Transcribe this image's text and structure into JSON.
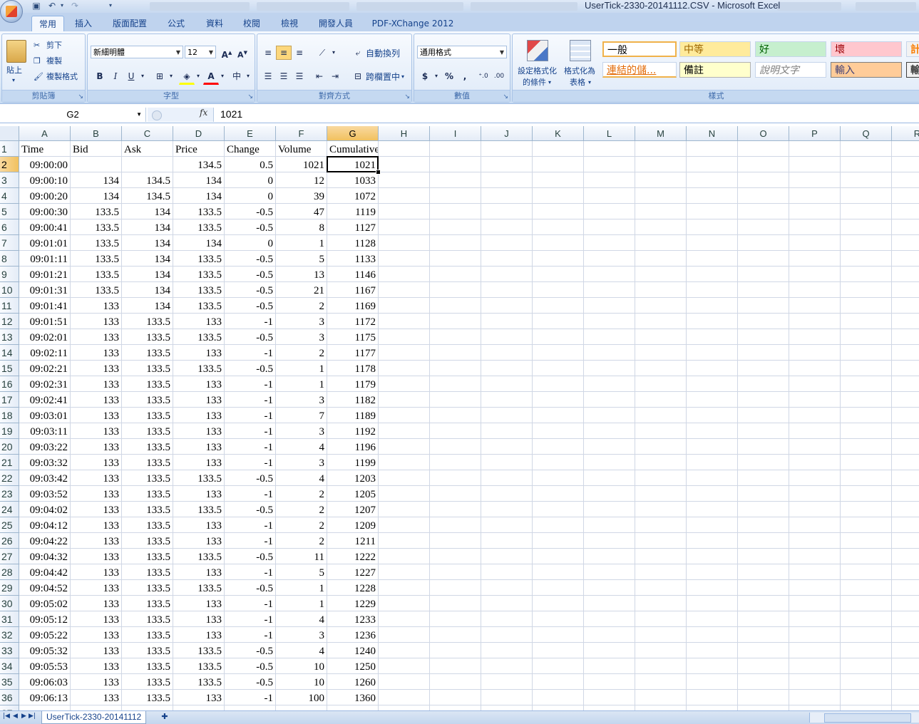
{
  "window": {
    "title": "UserTick-2330-20141112.CSV - Microsoft Excel"
  },
  "ribbon": {
    "tabs": [
      "常用",
      "插入",
      "版面配置",
      "公式",
      "資料",
      "校閱",
      "檢視",
      "開發人員",
      "PDF-XChange 2012"
    ],
    "active_tab": "常用",
    "clipboard": {
      "paste": "貼上",
      "cut": "剪下",
      "copy": "複製",
      "format_painter": "複製格式",
      "label": "剪貼簿"
    },
    "font": {
      "name": "新細明體",
      "size": "12",
      "label": "字型"
    },
    "alignment": {
      "wrap_text": "自動換列",
      "merge_center": "跨欄置中",
      "label": "對齊方式"
    },
    "number": {
      "format": "通用格式",
      "label": "數值"
    },
    "styles": {
      "conditional_formatting_1": "設定格式化",
      "conditional_formatting_2": "的條件",
      "format_as_table_1": "格式化為",
      "format_as_table_2": "表格",
      "normal": "一般",
      "neutral": "中等",
      "good": "好",
      "bad": "壞",
      "calc_partial": "計",
      "hyperlink": "連結的儲...",
      "note": "備註",
      "explanatory": "說明文字",
      "input": "輸入",
      "output_partial": "輸",
      "label": "樣式"
    }
  },
  "formula_bar": {
    "name_box": "G2",
    "fx": "fx",
    "value": "1021"
  },
  "sheet": {
    "columns": [
      "A",
      "B",
      "C",
      "D",
      "E",
      "F",
      "G",
      "H",
      "I",
      "J",
      "K",
      "L",
      "M",
      "N",
      "O",
      "P",
      "Q",
      "R"
    ],
    "selected_column": "G",
    "selected_row": 2,
    "header_row": [
      "Time",
      "Bid",
      "Ask",
      "Price",
      "Change",
      "Volume",
      "Cumulative"
    ],
    "rows": [
      [
        "09:00:00",
        "",
        "",
        "134.5",
        "0.5",
        "1021",
        "1021"
      ],
      [
        "09:00:10",
        "134",
        "134.5",
        "134",
        "0",
        "12",
        "1033"
      ],
      [
        "09:00:20",
        "134",
        "134.5",
        "134",
        "0",
        "39",
        "1072"
      ],
      [
        "09:00:30",
        "133.5",
        "134",
        "133.5",
        "-0.5",
        "47",
        "1119"
      ],
      [
        "09:00:41",
        "133.5",
        "134",
        "133.5",
        "-0.5",
        "8",
        "1127"
      ],
      [
        "09:01:01",
        "133.5",
        "134",
        "134",
        "0",
        "1",
        "1128"
      ],
      [
        "09:01:11",
        "133.5",
        "134",
        "133.5",
        "-0.5",
        "5",
        "1133"
      ],
      [
        "09:01:21",
        "133.5",
        "134",
        "133.5",
        "-0.5",
        "13",
        "1146"
      ],
      [
        "09:01:31",
        "133.5",
        "134",
        "133.5",
        "-0.5",
        "21",
        "1167"
      ],
      [
        "09:01:41",
        "133",
        "134",
        "133.5",
        "-0.5",
        "2",
        "1169"
      ],
      [
        "09:01:51",
        "133",
        "133.5",
        "133",
        "-1",
        "3",
        "1172"
      ],
      [
        "09:02:01",
        "133",
        "133.5",
        "133.5",
        "-0.5",
        "3",
        "1175"
      ],
      [
        "09:02:11",
        "133",
        "133.5",
        "133",
        "-1",
        "2",
        "1177"
      ],
      [
        "09:02:21",
        "133",
        "133.5",
        "133.5",
        "-0.5",
        "1",
        "1178"
      ],
      [
        "09:02:31",
        "133",
        "133.5",
        "133",
        "-1",
        "1",
        "1179"
      ],
      [
        "09:02:41",
        "133",
        "133.5",
        "133",
        "-1",
        "3",
        "1182"
      ],
      [
        "09:03:01",
        "133",
        "133.5",
        "133",
        "-1",
        "7",
        "1189"
      ],
      [
        "09:03:11",
        "133",
        "133.5",
        "133",
        "-1",
        "3",
        "1192"
      ],
      [
        "09:03:22",
        "133",
        "133.5",
        "133",
        "-1",
        "4",
        "1196"
      ],
      [
        "09:03:32",
        "133",
        "133.5",
        "133",
        "-1",
        "3",
        "1199"
      ],
      [
        "09:03:42",
        "133",
        "133.5",
        "133.5",
        "-0.5",
        "4",
        "1203"
      ],
      [
        "09:03:52",
        "133",
        "133.5",
        "133",
        "-1",
        "2",
        "1205"
      ],
      [
        "09:04:02",
        "133",
        "133.5",
        "133.5",
        "-0.5",
        "2",
        "1207"
      ],
      [
        "09:04:12",
        "133",
        "133.5",
        "133",
        "-1",
        "2",
        "1209"
      ],
      [
        "09:04:22",
        "133",
        "133.5",
        "133",
        "-1",
        "2",
        "1211"
      ],
      [
        "09:04:32",
        "133",
        "133.5",
        "133.5",
        "-0.5",
        "11",
        "1222"
      ],
      [
        "09:04:42",
        "133",
        "133.5",
        "133",
        "-1",
        "5",
        "1227"
      ],
      [
        "09:04:52",
        "133",
        "133.5",
        "133.5",
        "-0.5",
        "1",
        "1228"
      ],
      [
        "09:05:02",
        "133",
        "133.5",
        "133",
        "-1",
        "1",
        "1229"
      ],
      [
        "09:05:12",
        "133",
        "133.5",
        "133",
        "-1",
        "4",
        "1233"
      ],
      [
        "09:05:22",
        "133",
        "133.5",
        "133",
        "-1",
        "3",
        "1236"
      ],
      [
        "09:05:32",
        "133",
        "133.5",
        "133.5",
        "-0.5",
        "4",
        "1240"
      ],
      [
        "09:05:53",
        "133",
        "133.5",
        "133.5",
        "-0.5",
        "10",
        "1250"
      ],
      [
        "09:06:03",
        "133",
        "133.5",
        "133.5",
        "-0.5",
        "10",
        "1260"
      ],
      [
        "09:06:13",
        "133",
        "133.5",
        "133",
        "-1",
        "100",
        "1360"
      ]
    ]
  },
  "sheet_tabs": {
    "active": "UserTick-2330-20141112"
  },
  "colors": {
    "ribbon_blue": "#bfd3ee",
    "selected_header": "#f1c15f",
    "gridline": "#d0d7e5",
    "tab_text": "#15428b"
  }
}
